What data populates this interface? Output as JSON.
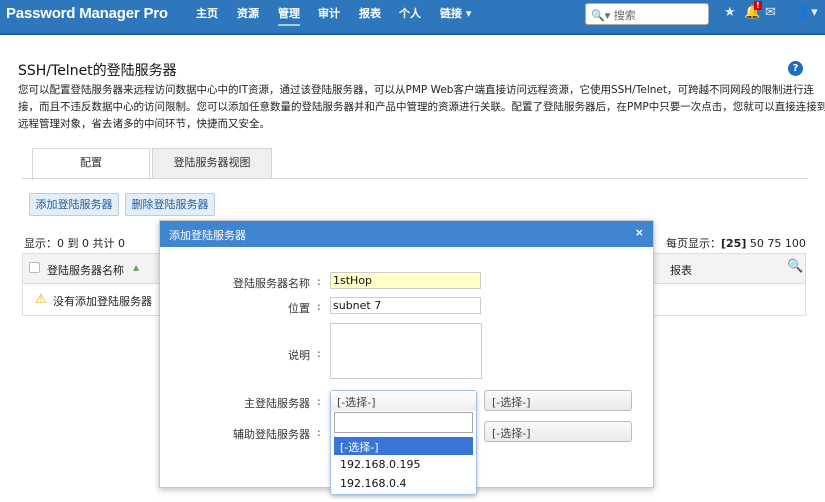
{
  "header": {
    "logo": "Password Manager Pro",
    "nav": [
      "主页",
      "资源",
      "管理",
      "审计",
      "报表",
      "个人",
      "链接 ▾"
    ],
    "active_nav": 2,
    "search_placeholder": "搜索",
    "notification_badge": "!"
  },
  "page": {
    "title": "SSH/Telnet的登陆服务器",
    "description": [
      "您可以配置登陆服务器来远程访问数据中心中的IT资源，通过该登陆服务器，可以从PMP Web客户端直接访问远程资源，它使用SSH/Telnet，可跨越不同网段的限制进行连",
      "接，而且不违反数据中心的访问限制。您可以添加任意数量的登陆服务器并和产品中管理的资源进行关联。配置了登陆服务器后，在PMP中只要一次点击，您就可以直接连接到",
      "远程管理对象，省去诸多的中间环节，快捷而又安全。"
    ],
    "help": "?"
  },
  "tabs": [
    "配置",
    "登陆服务器视图"
  ],
  "buttons": {
    "add": "添加登陆服务器",
    "delete": "删除登陆服务器"
  },
  "paging": {
    "showing": "显示：0 到 0 共计 0",
    "per_page_label": "每页显示：",
    "current": "[25]",
    "options": "50 75 100"
  },
  "table": {
    "col_name": "登陆服务器名称",
    "col_report": "报表",
    "empty": "没有添加登陆服务器"
  },
  "dialog": {
    "title": "添加登陆服务器",
    "close": "×",
    "fields": {
      "name_label": "登陆服务器名称",
      "name_value": "1stHop",
      "location_label": "位置",
      "location_value": "subnet 7",
      "desc_label": "说明",
      "desc_value": "",
      "primary_label": "主登陆服务器",
      "secondary_label": "辅助登陆服务器",
      "colon": ":"
    },
    "primary_select": "[-选择-]",
    "primary_port_select": "[-选择-]",
    "secondary_port_select": "[-选择-]",
    "dropdown_options": [
      "[-选择-]",
      "192.168.0.195",
      "192.168.0.4"
    ]
  },
  "colors": {
    "header": "#2f77bd",
    "dialog_header": "#4085cf",
    "highlight": "#3875d7"
  }
}
